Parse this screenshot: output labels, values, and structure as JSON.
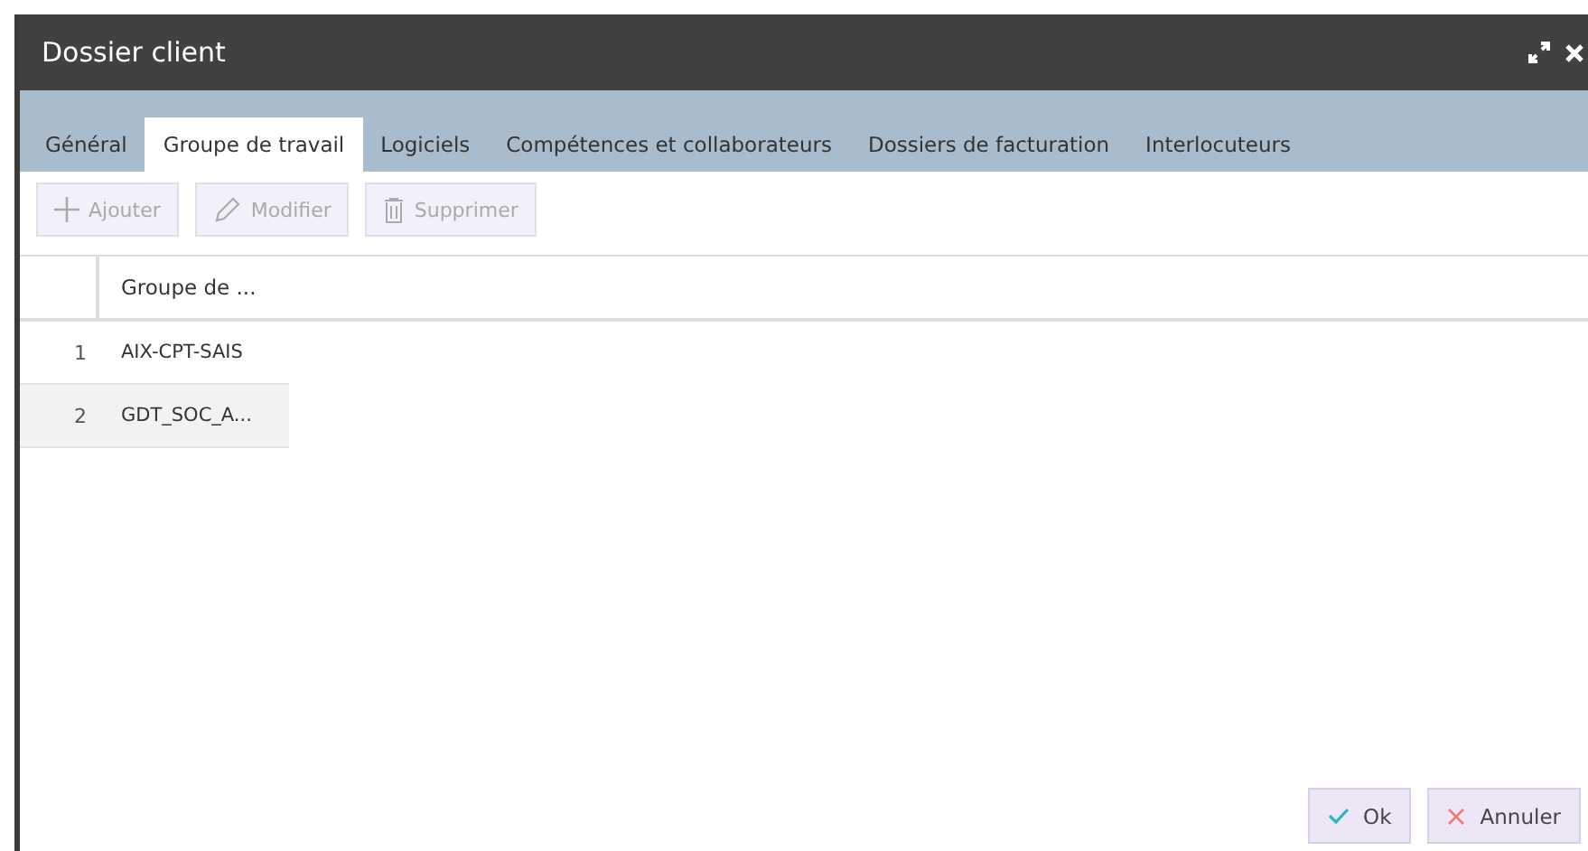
{
  "window": {
    "title": "Dossier client"
  },
  "tabs": [
    {
      "label": "Général",
      "selected": false
    },
    {
      "label": "Groupe de travail",
      "selected": true
    },
    {
      "label": "Logiciels",
      "selected": false
    },
    {
      "label": "Compétences et collaborateurs",
      "selected": false
    },
    {
      "label": "Dossiers de facturation",
      "selected": false
    },
    {
      "label": "Interlocuteurs",
      "selected": false
    }
  ],
  "toolbar": [
    {
      "kind": "add",
      "label": "Ajouter",
      "disabled": true
    },
    {
      "kind": "edit",
      "label": "Modifier",
      "disabled": true
    },
    {
      "kind": "delete",
      "label": "Supprimer",
      "disabled": true
    }
  ],
  "table": {
    "columns": [
      "Groupe de ..."
    ],
    "rows": [
      {
        "number": "1",
        "cells": [
          "AIX-CPT-SAIS"
        ],
        "selected": false
      },
      {
        "number": "2",
        "cells": [
          "GDT_SOC_A..."
        ],
        "selected": true
      }
    ]
  },
  "buttons": [
    {
      "kind": "ok",
      "label": "Ok"
    },
    {
      "kind": "cancel",
      "label": "Annuler"
    }
  ]
}
